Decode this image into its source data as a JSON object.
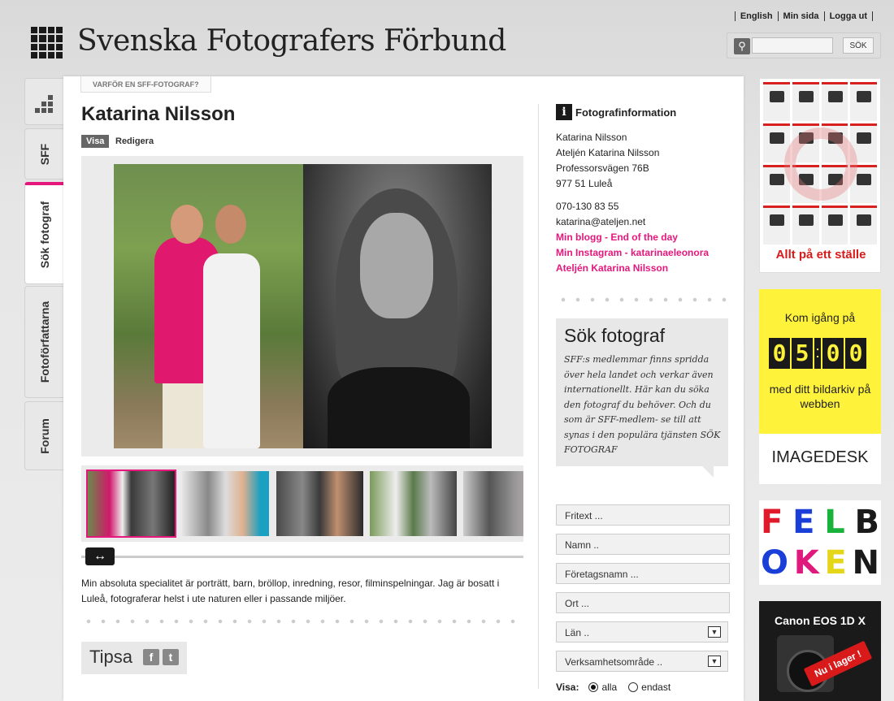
{
  "topnav": [
    "English",
    "Min sida",
    "Logga ut"
  ],
  "site_title": "Svenska Fotografers Förbund",
  "search": {
    "placeholder": "",
    "button": "SÖK"
  },
  "tabs": [
    {
      "label": "SFF"
    },
    {
      "label": "Sök fotograf"
    },
    {
      "label": "Fotoförfattarna"
    },
    {
      "label": "Forum"
    }
  ],
  "breadcrumb": "VARFÖR EN SFF-FOTOGRAF?",
  "profile": {
    "name": "Katarina Nilsson",
    "visa": "Visa",
    "redigera": "Redigera",
    "bio": "Min absoluta specialitet är porträtt, barn, bröllop, inredning, resor, filminspelningar. Jag är bosatt i Luleå, fotograferar helst i ute naturen eller i passande miljöer."
  },
  "tipsa": {
    "label": "Tipsa",
    "facebook": "f",
    "twitter": "t"
  },
  "info": {
    "title": "Fotografinformation",
    "name": "Katarina Nilsson",
    "company": "Ateljén Katarina Nilsson",
    "street": "Professorsvägen 76B",
    "city": "977 51 Luleå",
    "phone": "070-130 83 55",
    "email": "katarina@ateljen.net",
    "links": [
      "Min blogg - End of the day",
      "Min Instagram - katarinaeleonora",
      "Ateljén Katarina Nilsson"
    ]
  },
  "sok_box": {
    "title": "Sök fotograf",
    "text": "SFF:s medlemmar finns spridda över hela landet och verkar även internationellt. Här kan du söka den fotograf du behöver. Och du som är SFF-medlem- se till att synas i den populära tjänsten SÖK FOTOGRAF"
  },
  "search_form": {
    "fritext": "Fritext ...",
    "namn": "Namn ..",
    "foretag": "Företagsnamn ...",
    "ort": "Ort ...",
    "lan": "Län ..",
    "verksamhet": "Verksamhetsområde ..",
    "visa_label": "Visa:",
    "opt_alla": "alla",
    "opt_endast": "endast"
  },
  "ads": {
    "ad1_caption": "Allt på ett ställe",
    "ad2_top": "Kom igång på",
    "ad2_clock": [
      "0",
      "5",
      "0",
      "0"
    ],
    "ad2_mid": "med ditt bildarkiv på webben",
    "ad2_brand": "IMAGEDESK",
    "ad3_row1": [
      "F",
      "E",
      "L",
      "B"
    ],
    "ad3_row2": [
      "O",
      "K",
      "E",
      "N"
    ],
    "ad3_colors1": [
      "#e01a2a",
      "#1a3fd8",
      "#19b23a",
      "#1a1a1a"
    ],
    "ad3_colors2": [
      "#1a3fd8",
      "#e0197d",
      "#e6d61a",
      "#1a1a1a"
    ],
    "ad4_title": "Canon EOS 1D X",
    "ad4_badge": "Nu i lager !"
  },
  "colors": {
    "accent": "#e5177d",
    "ad_red": "#d91a1a",
    "ad_yellow": "#fff23a"
  }
}
